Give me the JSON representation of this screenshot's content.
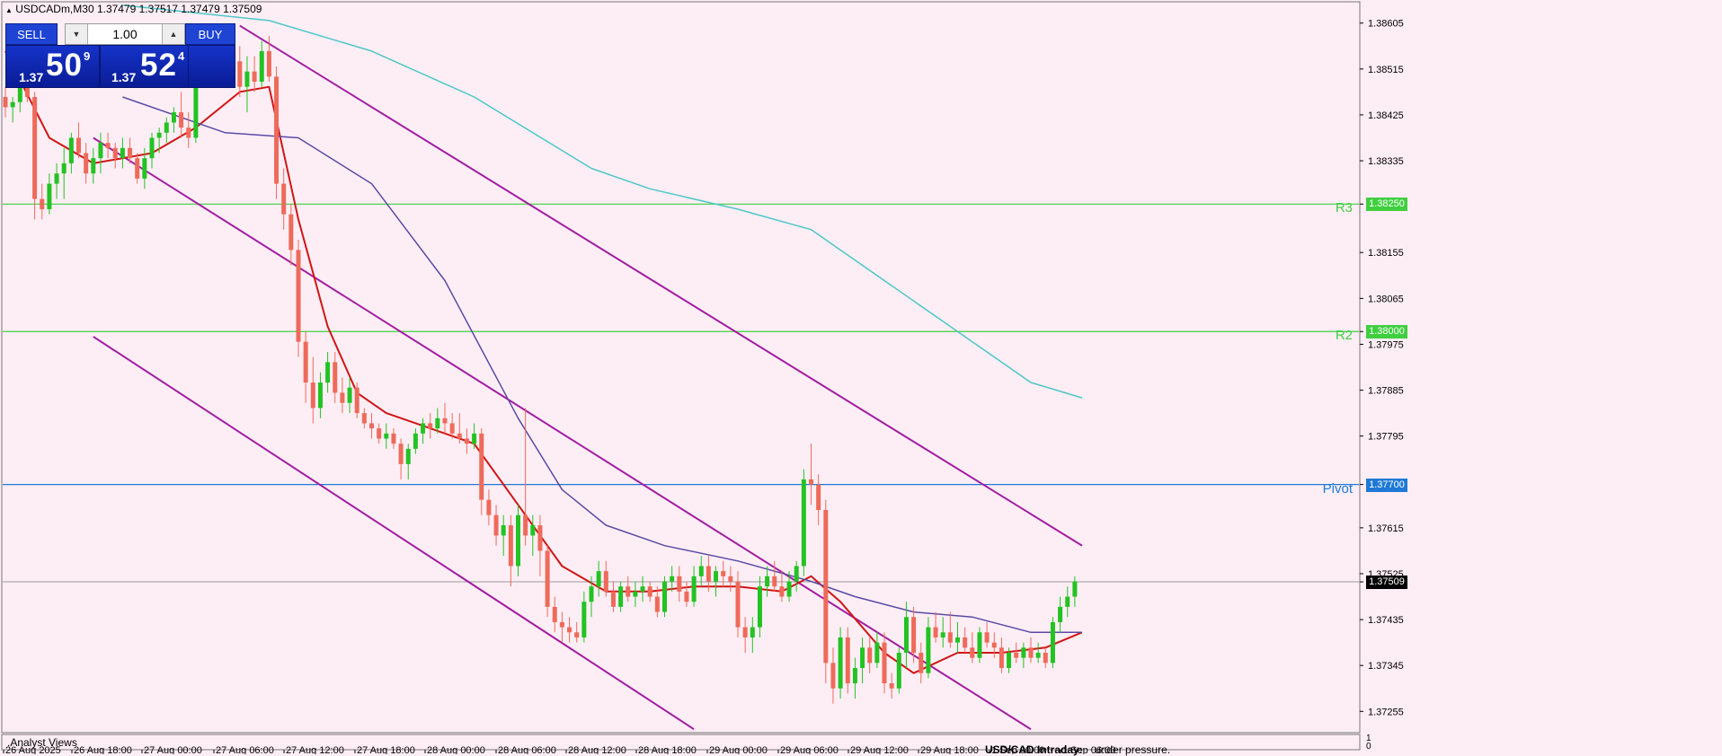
{
  "header": {
    "symbol_line": "USDCADm,M30  1.37479 1.37517 1.37479 1.37509"
  },
  "trade_panel": {
    "sell_label": "SELL",
    "buy_label": "BUY",
    "lot_value": "1.00",
    "sell_prefix": "1.37",
    "sell_big": "50",
    "sell_sup": "9",
    "buy_prefix": "1.37",
    "buy_big": "52",
    "buy_sup": "4"
  },
  "indicator_window": {
    "label": ".Analyst Views",
    "ticker_title": "USD/CAD Intraday:",
    "ticker_text": "under pressure.",
    "scale_top": "1",
    "scale_bottom": "0"
  },
  "colors": {
    "background": "#fdeef5",
    "bull_candle": "#22c322",
    "bear_candle": "#ee6a5a",
    "fast_ma": "#d01515",
    "mid_ma": "#5a4aa6",
    "slow_ma": "#4ec7c7",
    "channel": "#a21ca2",
    "resistance": "#3fcf3f",
    "pivot": "#1e7ad6"
  },
  "chart_data": {
    "type": "candlestick",
    "ylim": [
      1.37215,
      1.38645
    ],
    "y_ticks": [
      "1.38605",
      "1.38515",
      "1.38425",
      "1.38335",
      "1.38250",
      "1.38155",
      "1.38065",
      "1.38000",
      "1.37975",
      "1.37885",
      "1.37795",
      "1.37700",
      "1.37615",
      "1.37525",
      "1.37509",
      "1.37435",
      "1.37345",
      "1.37255"
    ],
    "x_labels": [
      "26 Aug 2025",
      "26 Aug 18:00",
      "27 Aug 00:00",
      "27 Aug 06:00",
      "27 Aug 12:00",
      "27 Aug 18:00",
      "28 Aug 00:00",
      "28 Aug 06:00",
      "28 Aug 12:00",
      "28 Aug 18:00",
      "29 Aug 00:00",
      "29 Aug 06:00",
      "29 Aug 12:00",
      "29 Aug 18:00",
      "1 Sep 00:00",
      "1 Sep 06:00"
    ],
    "levels": [
      {
        "name": "R3",
        "value": 1.3825,
        "tag": "1.38250",
        "color": "#3fcf3f"
      },
      {
        "name": "R2",
        "value": 1.38,
        "tag": "1.38000",
        "color": "#3fcf3f"
      },
      {
        "name": "Pivot",
        "value": 1.377,
        "tag": "1.37700",
        "color": "#1e7ad6"
      }
    ],
    "current_price": {
      "value": 1.37509,
      "tag": "1.37509"
    },
    "candles": [
      [
        1.3846,
        1.3848,
        1.3842,
        1.3844
      ],
      [
        1.3844,
        1.3846,
        1.3841,
        1.3845
      ],
      [
        1.3845,
        1.3853,
        1.3843,
        1.3851
      ],
      [
        1.3851,
        1.3853,
        1.3845,
        1.3846
      ],
      [
        1.3846,
        1.3847,
        1.3822,
        1.3826
      ],
      [
        1.3826,
        1.3829,
        1.3822,
        1.3824
      ],
      [
        1.3824,
        1.3831,
        1.3823,
        1.3829
      ],
      [
        1.3829,
        1.3833,
        1.3826,
        1.3831
      ],
      [
        1.3831,
        1.3836,
        1.3826,
        1.3833
      ],
      [
        1.3833,
        1.3839,
        1.3831,
        1.3838
      ],
      [
        1.3838,
        1.3841,
        1.3834,
        1.3835
      ],
      [
        1.3835,
        1.3837,
        1.3829,
        1.3831
      ],
      [
        1.3831,
        1.3836,
        1.3829,
        1.3834
      ],
      [
        1.3834,
        1.3839,
        1.3831,
        1.3837
      ],
      [
        1.3837,
        1.3839,
        1.3834,
        1.3836
      ],
      [
        1.3836,
        1.3837,
        1.3832,
        1.3834
      ],
      [
        1.3834,
        1.3838,
        1.3832,
        1.3836
      ],
      [
        1.3836,
        1.3838,
        1.3833,
        1.3834
      ],
      [
        1.3834,
        1.3835,
        1.3829,
        1.383
      ],
      [
        1.383,
        1.3836,
        1.3828,
        1.3834
      ],
      [
        1.3834,
        1.3839,
        1.3832,
        1.3838
      ],
      [
        1.3838,
        1.384,
        1.3835,
        1.3839
      ],
      [
        1.3839,
        1.3842,
        1.3837,
        1.3841
      ],
      [
        1.3841,
        1.3844,
        1.3839,
        1.3843
      ],
      [
        1.3843,
        1.3847,
        1.3838,
        1.384
      ],
      [
        1.384,
        1.3843,
        1.3836,
        1.3838
      ],
      [
        1.3838,
        1.3856,
        1.3837,
        1.3854
      ],
      [
        1.3854,
        1.3857,
        1.3848,
        1.385
      ],
      [
        1.385,
        1.3858,
        1.3849,
        1.3856
      ],
      [
        1.3856,
        1.3858,
        1.385,
        1.3852
      ],
      [
        1.3852,
        1.3857,
        1.3849,
        1.3855
      ],
      [
        1.3855,
        1.3857,
        1.3851,
        1.3853
      ],
      [
        1.3853,
        1.3856,
        1.3846,
        1.3848
      ],
      [
        1.3848,
        1.3854,
        1.3843,
        1.3851
      ],
      [
        1.3851,
        1.3854,
        1.3847,
        1.3849
      ],
      [
        1.3849,
        1.3857,
        1.3848,
        1.3855
      ],
      [
        1.3855,
        1.3858,
        1.3849,
        1.385
      ],
      [
        1.385,
        1.3852,
        1.3826,
        1.3829
      ],
      [
        1.3829,
        1.3832,
        1.382,
        1.3823
      ],
      [
        1.3823,
        1.3825,
        1.3813,
        1.3816
      ],
      [
        1.3816,
        1.3818,
        1.3795,
        1.3798
      ],
      [
        1.3798,
        1.38,
        1.3786,
        1.379
      ],
      [
        1.379,
        1.3795,
        1.3782,
        1.3785
      ],
      [
        1.3785,
        1.3792,
        1.3783,
        1.379
      ],
      [
        1.379,
        1.3796,
        1.3788,
        1.3794
      ],
      [
        1.3794,
        1.3796,
        1.3786,
        1.3788
      ],
      [
        1.3788,
        1.3791,
        1.3784,
        1.3786
      ],
      [
        1.3786,
        1.3791,
        1.3784,
        1.3789
      ],
      [
        1.3789,
        1.379,
        1.3783,
        1.3784
      ],
      [
        1.3784,
        1.3785,
        1.3781,
        1.3782
      ],
      [
        1.3782,
        1.3784,
        1.3779,
        1.3781
      ],
      [
        1.3781,
        1.3782,
        1.3778,
        1.3779
      ],
      [
        1.3779,
        1.3782,
        1.3777,
        1.378
      ],
      [
        1.378,
        1.3781,
        1.3777,
        1.3778
      ],
      [
        1.3778,
        1.3779,
        1.3771,
        1.3774
      ],
      [
        1.3774,
        1.3778,
        1.3771,
        1.3777
      ],
      [
        1.3777,
        1.3781,
        1.3776,
        1.378
      ],
      [
        1.378,
        1.3783,
        1.3778,
        1.3782
      ],
      [
        1.3782,
        1.3784,
        1.3779,
        1.3781
      ],
      [
        1.3781,
        1.3785,
        1.378,
        1.3783
      ],
      [
        1.3783,
        1.3786,
        1.378,
        1.3782
      ],
      [
        1.3782,
        1.3784,
        1.3779,
        1.378
      ],
      [
        1.378,
        1.3784,
        1.3778,
        1.3779
      ],
      [
        1.3779,
        1.3781,
        1.3776,
        1.3778
      ],
      [
        1.3778,
        1.3782,
        1.3777,
        1.378
      ],
      [
        1.378,
        1.3781,
        1.3764,
        1.3767
      ],
      [
        1.3767,
        1.3769,
        1.3762,
        1.3764
      ],
      [
        1.3764,
        1.3766,
        1.3758,
        1.376
      ],
      [
        1.376,
        1.3764,
        1.3756,
        1.3762
      ],
      [
        1.3762,
        1.3764,
        1.375,
        1.3754
      ],
      [
        1.3754,
        1.3766,
        1.3752,
        1.3764
      ],
      [
        1.3764,
        1.3785,
        1.3758,
        1.376
      ],
      [
        1.376,
        1.3764,
        1.3756,
        1.3762
      ],
      [
        1.3762,
        1.3764,
        1.3752,
        1.3757
      ],
      [
        1.3757,
        1.3758,
        1.3744,
        1.3746
      ],
      [
        1.3746,
        1.3748,
        1.3741,
        1.3743
      ],
      [
        1.3743,
        1.3745,
        1.3739,
        1.3742
      ],
      [
        1.3742,
        1.3744,
        1.3739,
        1.3741
      ],
      [
        1.3741,
        1.3743,
        1.3739,
        1.374
      ],
      [
        1.374,
        1.3749,
        1.3739,
        1.3747
      ],
      [
        1.3747,
        1.3752,
        1.3744,
        1.375
      ],
      [
        1.375,
        1.3755,
        1.3748,
        1.3753
      ],
      [
        1.3753,
        1.3755,
        1.3748,
        1.3749
      ],
      [
        1.3749,
        1.3751,
        1.3745,
        1.3746
      ],
      [
        1.3746,
        1.3751,
        1.3745,
        1.375
      ],
      [
        1.375,
        1.3752,
        1.3747,
        1.3748
      ],
      [
        1.3748,
        1.3751,
        1.3746,
        1.3749
      ],
      [
        1.3749,
        1.3752,
        1.3747,
        1.375
      ],
      [
        1.375,
        1.3751,
        1.3747,
        1.3748
      ],
      [
        1.3748,
        1.375,
        1.3744,
        1.3745
      ],
      [
        1.3745,
        1.3752,
        1.3744,
        1.3751
      ],
      [
        1.3751,
        1.3754,
        1.3749,
        1.3752
      ],
      [
        1.3752,
        1.3754,
        1.3747,
        1.3749
      ],
      [
        1.3749,
        1.3751,
        1.3746,
        1.3747
      ],
      [
        1.3747,
        1.3754,
        1.3746,
        1.3752
      ],
      [
        1.3752,
        1.3756,
        1.375,
        1.3754
      ],
      [
        1.3754,
        1.3756,
        1.3749,
        1.3751
      ],
      [
        1.3751,
        1.3754,
        1.3748,
        1.3753
      ],
      [
        1.3753,
        1.3755,
        1.375,
        1.3752
      ],
      [
        1.3752,
        1.3754,
        1.3749,
        1.3751
      ],
      [
        1.3751,
        1.3753,
        1.374,
        1.3742
      ],
      [
        1.3742,
        1.3744,
        1.3737,
        1.374
      ],
      [
        1.374,
        1.3744,
        1.3737,
        1.3742
      ],
      [
        1.3742,
        1.3752,
        1.374,
        1.375
      ],
      [
        1.375,
        1.3754,
        1.3748,
        1.3752
      ],
      [
        1.3752,
        1.3755,
        1.3749,
        1.375
      ],
      [
        1.375,
        1.3753,
        1.3747,
        1.3748
      ],
      [
        1.3748,
        1.3753,
        1.3747,
        1.3751
      ],
      [
        1.3751,
        1.3755,
        1.3749,
        1.3754
      ],
      [
        1.3754,
        1.3773,
        1.3752,
        1.3771
      ],
      [
        1.3771,
        1.3778,
        1.3766,
        1.377
      ],
      [
        1.377,
        1.3772,
        1.3762,
        1.3765
      ],
      [
        1.3765,
        1.3767,
        1.3731,
        1.3735
      ],
      [
        1.3735,
        1.3738,
        1.3727,
        1.373
      ],
      [
        1.373,
        1.3742,
        1.3728,
        1.374
      ],
      [
        1.374,
        1.3742,
        1.3729,
        1.3731
      ],
      [
        1.3731,
        1.3736,
        1.3728,
        1.3734
      ],
      [
        1.3734,
        1.374,
        1.3731,
        1.3738
      ],
      [
        1.3738,
        1.374,
        1.3733,
        1.3735
      ],
      [
        1.3735,
        1.3741,
        1.3734,
        1.3739
      ],
      [
        1.3739,
        1.3741,
        1.3729,
        1.3731
      ],
      [
        1.3731,
        1.3733,
        1.3728,
        1.373
      ],
      [
        1.373,
        1.3738,
        1.3729,
        1.3737
      ],
      [
        1.3737,
        1.3747,
        1.3734,
        1.3744
      ],
      [
        1.3744,
        1.3746,
        1.3735,
        1.3737
      ],
      [
        1.3737,
        1.3739,
        1.3731,
        1.3733
      ],
      [
        1.3733,
        1.3744,
        1.3732,
        1.3742
      ],
      [
        1.3742,
        1.3745,
        1.3739,
        1.374
      ],
      [
        1.374,
        1.3744,
        1.3738,
        1.3741
      ],
      [
        1.3741,
        1.3745,
        1.3738,
        1.3739
      ],
      [
        1.3739,
        1.3743,
        1.3737,
        1.374
      ],
      [
        1.374,
        1.3742,
        1.3737,
        1.3738
      ],
      [
        1.3738,
        1.3741,
        1.3735,
        1.3736
      ],
      [
        1.3736,
        1.3742,
        1.3735,
        1.3741
      ],
      [
        1.3741,
        1.3743,
        1.3738,
        1.3739
      ],
      [
        1.3739,
        1.3741,
        1.3736,
        1.3738
      ],
      [
        1.3738,
        1.374,
        1.3733,
        1.3734
      ],
      [
        1.3734,
        1.3738,
        1.3733,
        1.3737
      ],
      [
        1.3737,
        1.3739,
        1.3735,
        1.3736
      ],
      [
        1.3736,
        1.3739,
        1.3734,
        1.3738
      ],
      [
        1.3738,
        1.374,
        1.3735,
        1.3736
      ],
      [
        1.3736,
        1.3739,
        1.3735,
        1.3737
      ],
      [
        1.3737,
        1.3738,
        1.3734,
        1.3735
      ],
      [
        1.3735,
        1.3744,
        1.3734,
        1.3743
      ],
      [
        1.3743,
        1.3748,
        1.3741,
        1.3746
      ],
      [
        1.3746,
        1.375,
        1.3744,
        1.3748
      ],
      [
        1.3748,
        1.3752,
        1.3746,
        1.3751
      ]
    ],
    "moving_averages": [
      {
        "period_role": "fast",
        "color": "#d01515",
        "points": [
          [
            0,
            1.3855
          ],
          [
            6,
            1.3838
          ],
          [
            12,
            1.3833
          ],
          [
            20,
            1.3835
          ],
          [
            26,
            1.384
          ],
          [
            32,
            1.3847
          ],
          [
            36,
            1.3848
          ],
          [
            40,
            1.3822
          ],
          [
            44,
            1.3801
          ],
          [
            48,
            1.3788
          ],
          [
            52,
            1.3784
          ],
          [
            58,
            1.3781
          ],
          [
            64,
            1.3778
          ],
          [
            70,
            1.3766
          ],
          [
            76,
            1.3754
          ],
          [
            82,
            1.3749
          ],
          [
            88,
            1.3749
          ],
          [
            94,
            1.375
          ],
          [
            100,
            1.375
          ],
          [
            106,
            1.3749
          ],
          [
            110,
            1.3752
          ],
          [
            114,
            1.3747
          ],
          [
            120,
            1.3737
          ],
          [
            124,
            1.3733
          ],
          [
            130,
            1.3737
          ],
          [
            136,
            1.3737
          ],
          [
            142,
            1.3738
          ],
          [
            147,
            1.3741
          ]
        ]
      },
      {
        "period_role": "mid",
        "color": "#5a4aa6",
        "points": [
          [
            16,
            1.3846
          ],
          [
            30,
            1.3839
          ],
          [
            40,
            1.3838
          ],
          [
            50,
            1.3829
          ],
          [
            60,
            1.381
          ],
          [
            70,
            1.3783
          ],
          [
            76,
            1.3769
          ],
          [
            82,
            1.3762
          ],
          [
            90,
            1.3758
          ],
          [
            100,
            1.3755
          ],
          [
            110,
            1.3751
          ],
          [
            116,
            1.3748
          ],
          [
            124,
            1.3745
          ],
          [
            132,
            1.3744
          ],
          [
            140,
            1.3741
          ],
          [
            147,
            1.3741
          ]
        ]
      },
      {
        "period_role": "slow",
        "color": "#4ec7c7",
        "points": [
          [
            16,
            1.3864
          ],
          [
            36,
            1.3861
          ],
          [
            50,
            1.3855
          ],
          [
            64,
            1.3846
          ],
          [
            80,
            1.3832
          ],
          [
            88,
            1.3828
          ],
          [
            100,
            1.3824
          ],
          [
            110,
            1.382
          ],
          [
            120,
            1.381
          ],
          [
            130,
            1.38
          ],
          [
            140,
            1.379
          ],
          [
            147,
            1.3787
          ]
        ]
      }
    ],
    "channel_lines": [
      {
        "from": [
          32,
          1.386
        ],
        "to": [
          147,
          1.3758
        ]
      },
      {
        "from": [
          12,
          1.3838
        ],
        "to": [
          140,
          1.3722
        ]
      },
      {
        "from": [
          12,
          1.3799
        ],
        "to": [
          94,
          1.3722
        ]
      }
    ]
  }
}
